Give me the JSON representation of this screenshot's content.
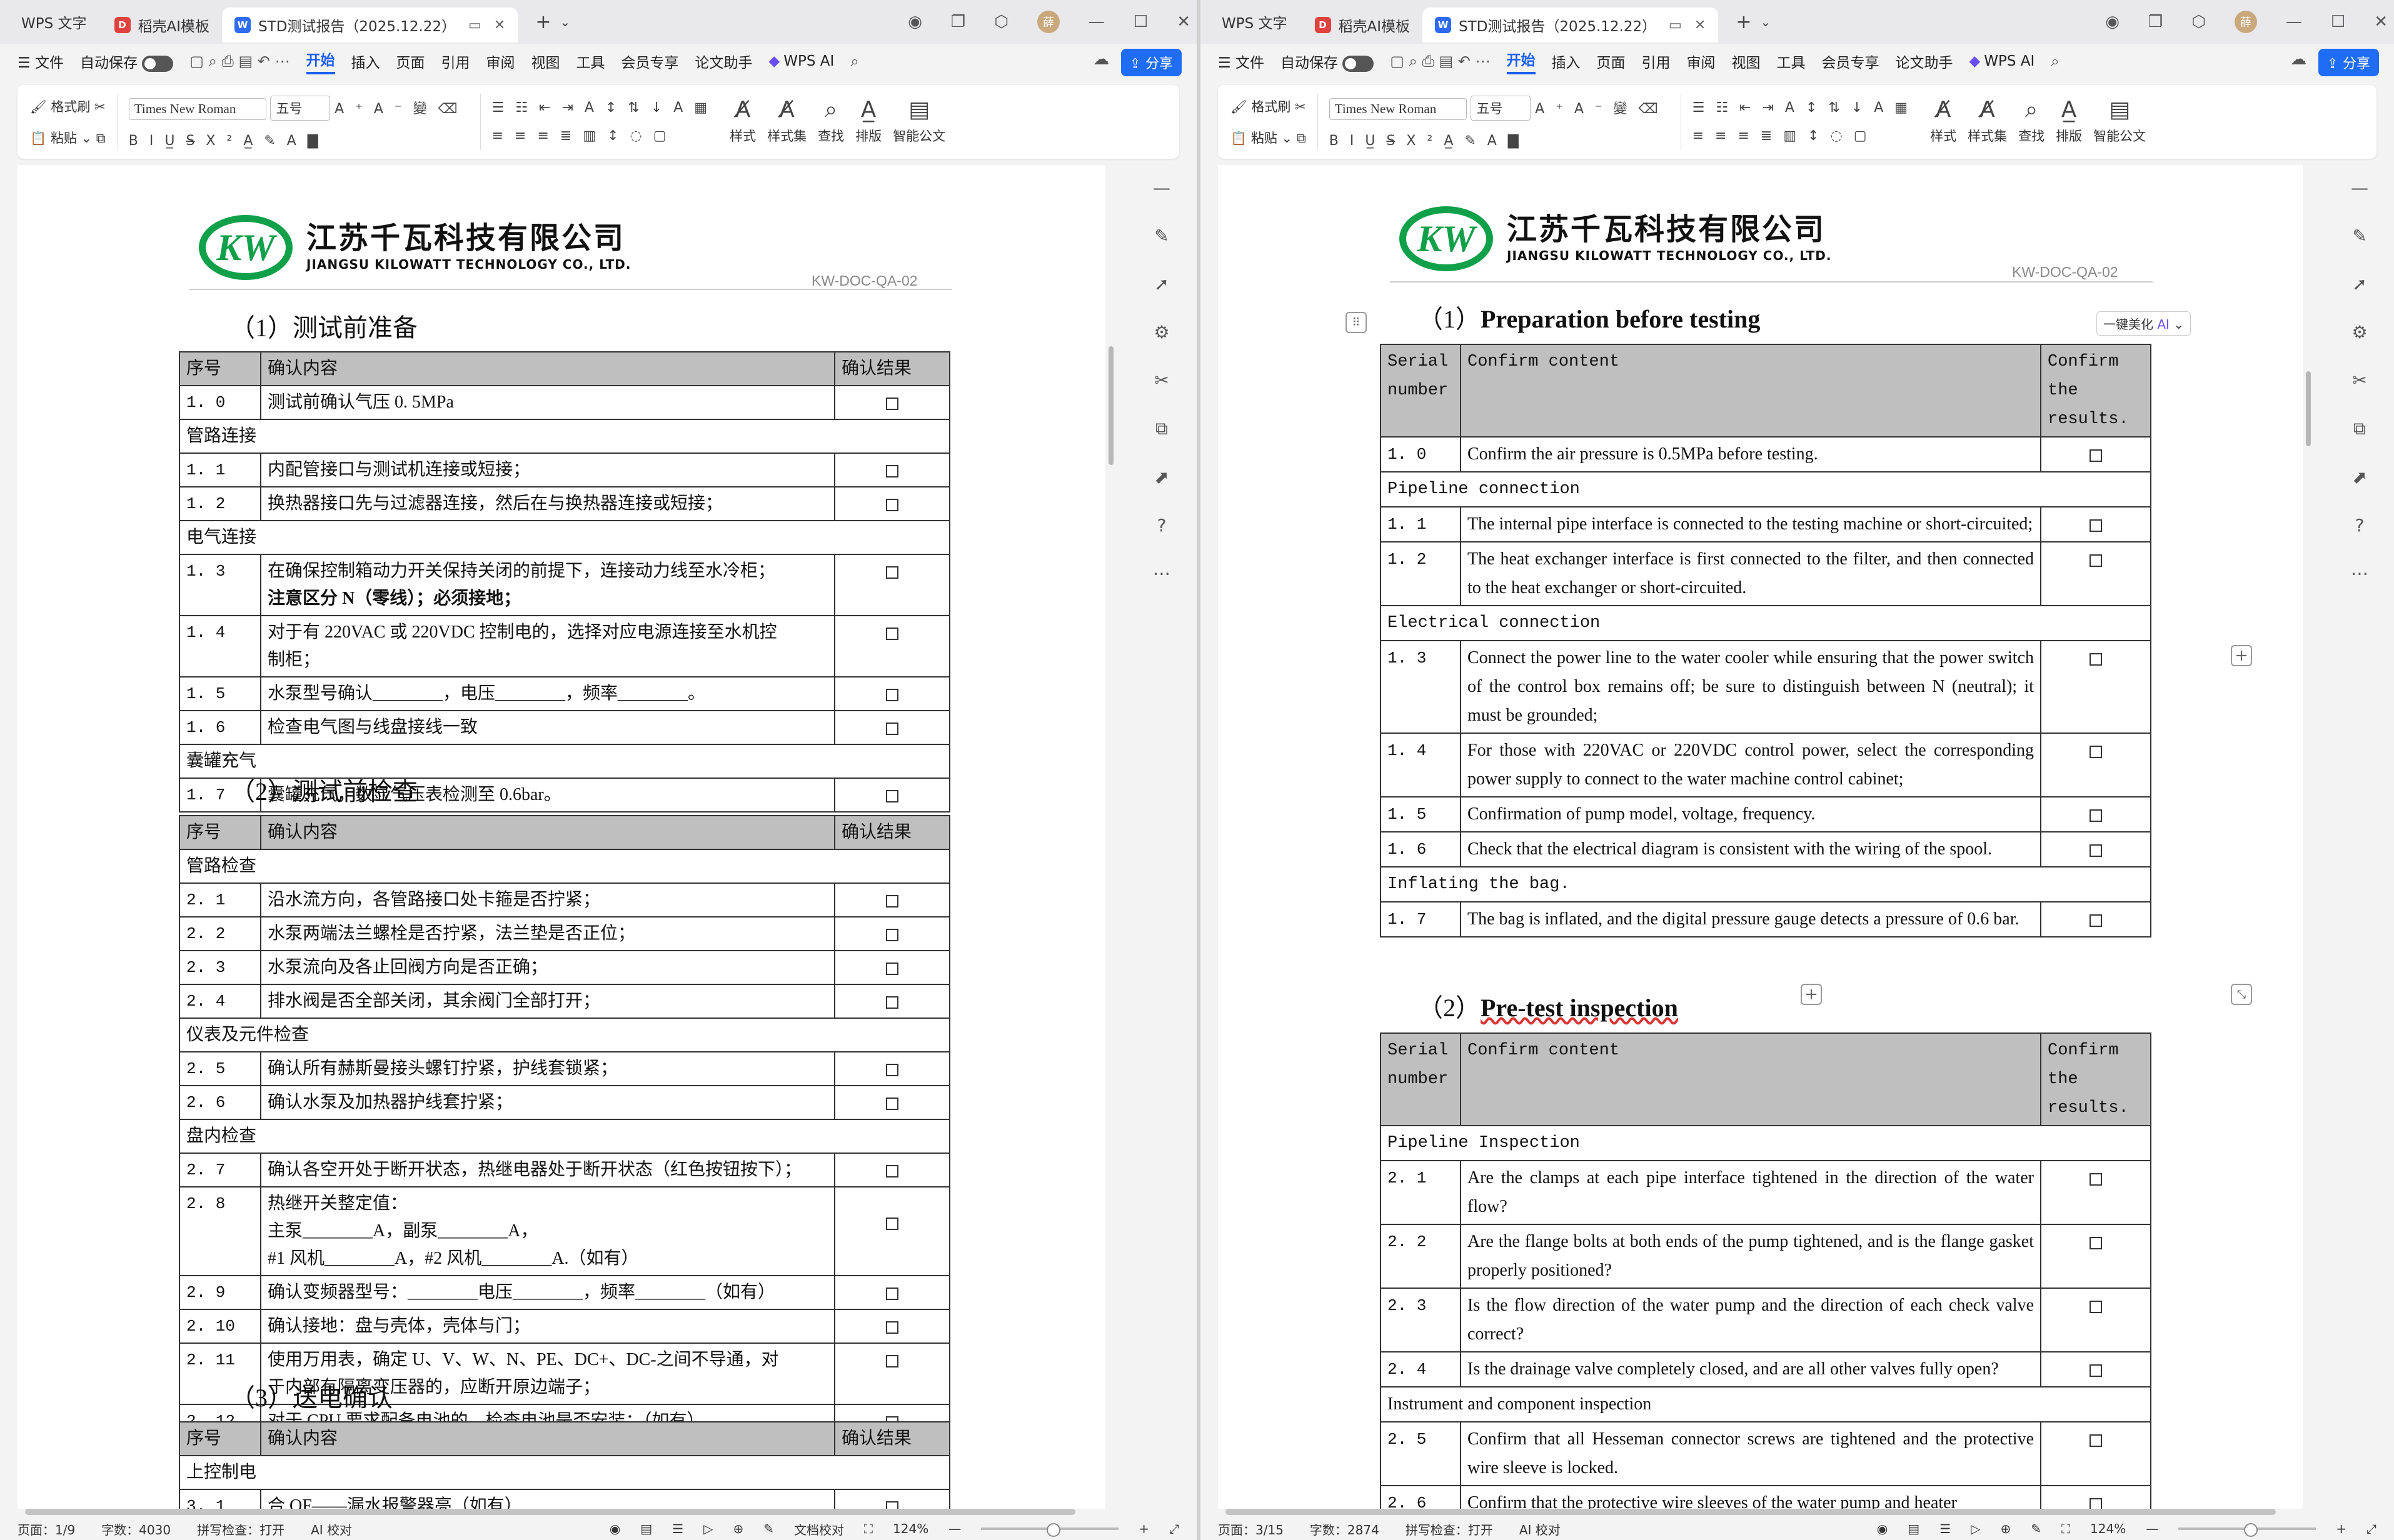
{
  "left": {
    "app": "WPS 文字",
    "tabs": [
      {
        "label": "稻壳AI模板"
      },
      {
        "label": "STD测试报告（2025.12.22）"
      }
    ],
    "avatar": "薛",
    "menu": [
      "文件",
      "自动保存",
      "开始",
      "插入",
      "页面",
      "引用",
      "审阅",
      "视图",
      "工具",
      "会员专享",
      "论文助手",
      "WPS AI"
    ],
    "share": "分享",
    "ribbon": {
      "format_painter": "格式刷",
      "paste": "粘贴",
      "font": "Times New Roman",
      "size": "五号",
      "styles": "样式",
      "style_set": "样式集",
      "find": "查找",
      "layout": "排版",
      "smart_doc": "智能公文"
    },
    "doc": {
      "company_cn": "江苏千瓦科技有限公司",
      "company_en": "JIANGSU KILOWATT TECHNOLOGY CO., LTD.",
      "doc_no": "KW-DOC-QA-02",
      "logo_text": "KW",
      "sec1": "（1）测试前准备",
      "sec2": "（2）测试前检查",
      "sec3": "（3）送电确认",
      "headers": [
        "序号",
        "确认内容",
        "确认结果"
      ],
      "rows1": [
        {
          "n": "1. 0",
          "t": "测试前确认气压 0. 5MPa"
        },
        {
          "g": "管路连接"
        },
        {
          "n": "1. 1",
          "t": "内配管接口与测试机连接或短接；"
        },
        {
          "n": "1. 2",
          "t": "换热器接口先与过滤器连接，然后在与换热器连接或短接；"
        },
        {
          "g": "电气连接"
        },
        {
          "n": "1. 3",
          "t": "在确保控制箱动力开关保持关闭的前提下，连接动力线至水冷柜；",
          "t2": "注意区分 N（零线）；必须接地；"
        },
        {
          "n": "1. 4",
          "t": "对于有 220VAC 或 220VDC 控制电的，选择对应电源连接至水机控",
          "t2": "制柜；"
        },
        {
          "n": "1. 5",
          "t": "水泵型号确认________，电压________，频率________。"
        },
        {
          "n": "1. 6",
          "t": "检查电气图与线盘接线一致"
        },
        {
          "g": "囊罐充气"
        },
        {
          "n": "1. 7",
          "t": "囊罐充气，数显气压表检测至 0.6bar。"
        }
      ],
      "rows2": [
        {
          "g": "管路检查"
        },
        {
          "n": "2. 1",
          "t": "沿水流方向，各管路接口处卡箍是否拧紧；"
        },
        {
          "n": "2. 2",
          "t": "水泵两端法兰螺栓是否拧紧，法兰垫是否正位；"
        },
        {
          "n": "2. 3",
          "t": "水泵流向及各止回阀方向是否正确；"
        },
        {
          "n": "2. 4",
          "t": "排水阀是否全部关闭，其余阀门全部打开；"
        },
        {
          "g": "仪表及元件检查"
        },
        {
          "n": "2. 5",
          "t": "确认所有赫斯曼接头螺钉拧紧，护线套锁紧；"
        },
        {
          "n": "2. 6",
          "t": "确认水泵及加热器护线套拧紧；"
        },
        {
          "g": "盘内检查"
        },
        {
          "n": "2. 7",
          "t": "确认各空开处于断开状态，热继电器处于断开状态（红色按钮按下）；"
        },
        {
          "n": "2. 8",
          "t": "热继开关整定值：",
          "t2": "主泵________A，副泵________A，",
          "t3": "#1 风机________A，#2 风机________A.（如有）"
        },
        {
          "n": "2. 9",
          "t": "确认变频器型号：________电压________，频率________（如有）"
        },
        {
          "n": "2. 10",
          "t": "确认接地：盘与壳体，壳体与门；"
        },
        {
          "n": "2. 11",
          "t": "使用万用表，确定 U、V、W、N、PE、DC+、DC-之间不导通，对",
          "t2": "于内部有隔离变压器的，应断开原边端子；"
        },
        {
          "n": "2. 12",
          "t": "对于 CPU 要求配备电池的，检查电池是否安装；（如有）"
        }
      ],
      "rows3": [
        {
          "g": "上控制电"
        },
        {
          "n": "3. 1",
          "t": "合 QF——漏水报警器亮（如有）"
        }
      ]
    },
    "status": {
      "page": "页面：1/9",
      "words": "字数：4030",
      "spell": "拼写检查：打开",
      "ai": "AI 校对",
      "layout": "文档校对",
      "zoom": "124%"
    }
  },
  "right": {
    "app": "WPS 文字",
    "tabs": [
      {
        "label": "稻壳AI模板"
      },
      {
        "label": "STD测试报告（2025.12.22）"
      }
    ],
    "avatar": "薛",
    "menu": [
      "文件",
      "自动保存",
      "开始",
      "插入",
      "页面",
      "引用",
      "审阅",
      "视图",
      "工具",
      "会员专享",
      "论文助手",
      "WPS AI"
    ],
    "share": "分享",
    "ribbon": {
      "format_painter": "格式刷",
      "paste": "粘贴",
      "font": "Times New Roman",
      "size": "五号",
      "styles": "样式",
      "style_set": "样式集",
      "find": "查找",
      "layout": "排版",
      "smart_doc": "智能公文"
    },
    "beautify": "一键美化",
    "doc": {
      "company_cn": "江苏千瓦科技有限公司",
      "company_en": "JIANGSU KILOWATT TECHNOLOGY CO., LTD.",
      "doc_no": "KW-DOC-QA-02",
      "logo_text": "KW",
      "sec1_prefix": "（1）",
      "sec1": "Preparation before testing",
      "sec2_prefix": "（2）",
      "sec2": "Pre-test inspection",
      "headers": [
        "Serial number",
        "Confirm content",
        "Confirm the results."
      ],
      "rows1": [
        {
          "n": "1. 0",
          "t": "Confirm the air pressure is 0.5MPa before testing."
        },
        {
          "g": "Pipeline connection"
        },
        {
          "n": "1. 1",
          "t": "The internal pipe interface is connected to the testing machine or short-circuited;"
        },
        {
          "n": "1. 2",
          "t": "The heat exchanger interface is first connected to the filter, and then connected to the heat exchanger or short-circuited."
        },
        {
          "g": "Electrical connection"
        },
        {
          "n": "1. 3",
          "t": "Connect the power line to the water cooler while ensuring that the power switch of the control box remains off; be sure to distinguish between N (neutral); it must be grounded;"
        },
        {
          "n": "1. 4",
          "t": "For those with 220VAC or 220VDC control power, select the corresponding power supply to connect to the water machine control cabinet;"
        },
        {
          "n": "1. 5",
          "t": "Confirmation of pump model, voltage, frequency."
        },
        {
          "n": "1. 6",
          "t": "Check that the electrical diagram is consistent with the wiring of the spool."
        },
        {
          "g": "Inflating the bag."
        },
        {
          "n": "1. 7",
          "t": "The bag is inflated, and the digital pressure gauge detects a pressure of 0.6 bar."
        }
      ],
      "rows2": [
        {
          "g": "Pipeline Inspection"
        },
        {
          "n": "2. 1",
          "t": "Are the clamps at each pipe interface tightened in the direction of the water flow?"
        },
        {
          "n": "2. 2",
          "t": "Are the flange bolts at both ends of the pump tightened, and is the flange gasket properly positioned?"
        },
        {
          "n": "2. 3",
          "t": "Is the flow direction of the water pump and the direction of each check valve correct?"
        },
        {
          "n": "2. 4",
          "t": "Is the drainage valve completely closed, and are all other valves fully open?"
        },
        {
          "g2": "Instrument and component inspection"
        },
        {
          "n": "2. 5",
          "t": "Confirm that all Hesseman connector screws are tightened and the protective wire sleeve is locked."
        },
        {
          "n": "2. 6",
          "t": "Confirm that the protective wire sleeves of the water pump and heater"
        }
      ]
    },
    "status": {
      "page": "页面：3/15",
      "words": "字数：2874",
      "spell": "拼写检查：打开",
      "ai": "AI 校对",
      "zoom": "124%"
    }
  }
}
